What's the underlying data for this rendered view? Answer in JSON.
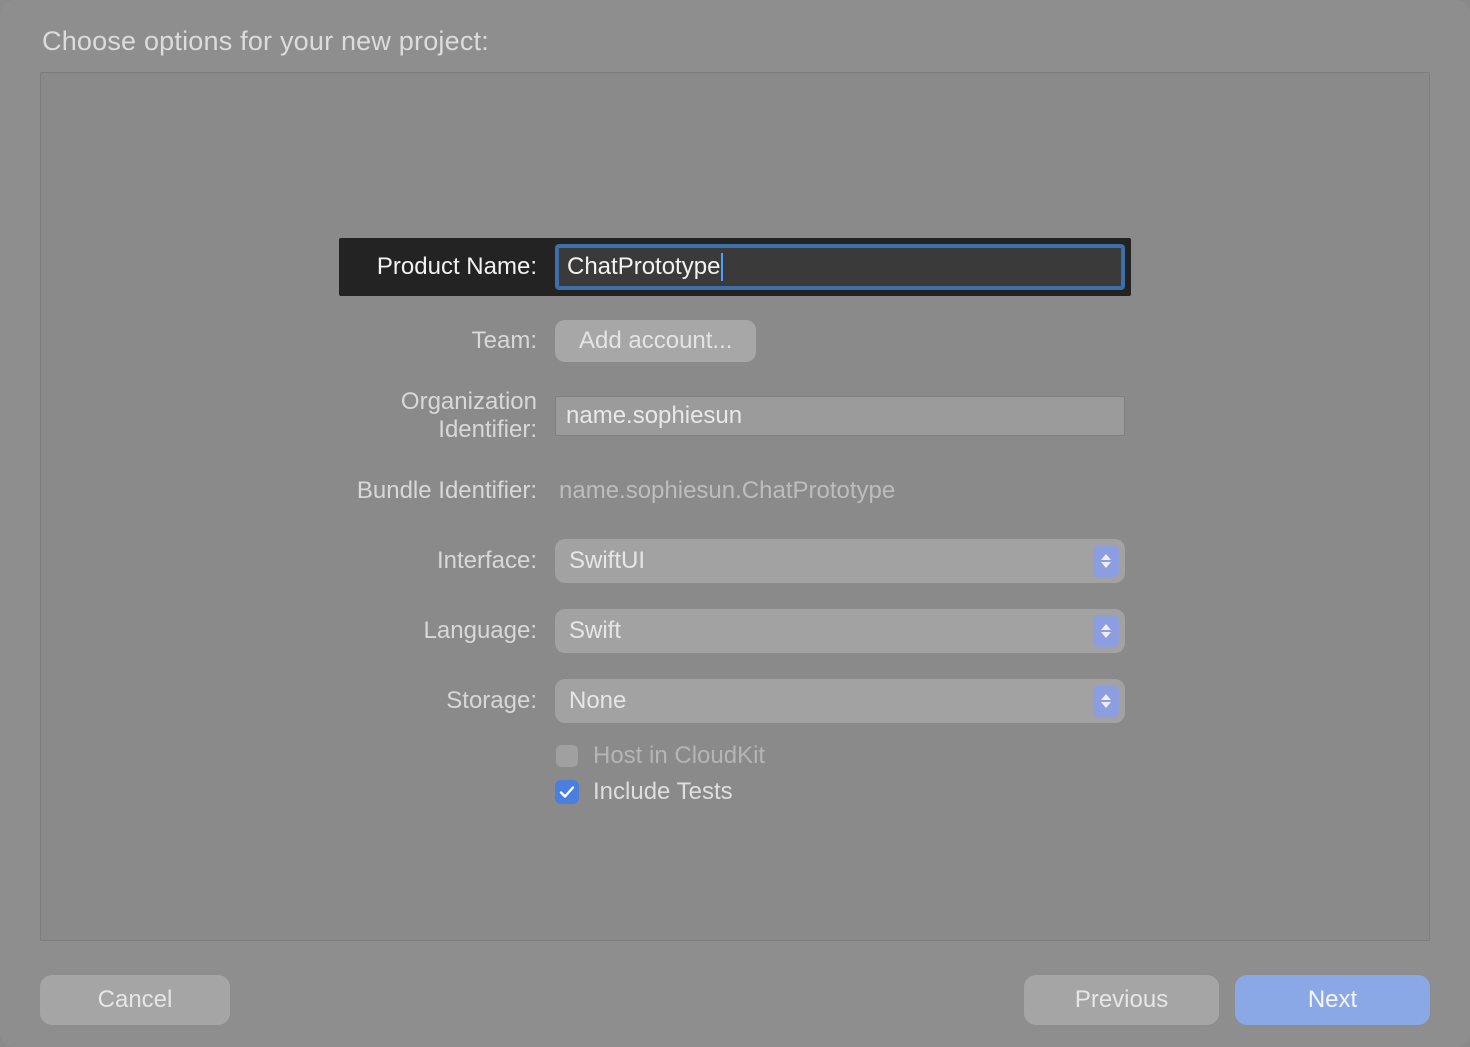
{
  "dialog": {
    "title": "Choose options for your new project:"
  },
  "form": {
    "product_name": {
      "label": "Product Name:",
      "value": "ChatPrototype"
    },
    "team": {
      "label": "Team:",
      "button": "Add account..."
    },
    "org_identifier": {
      "label": "Organization Identifier:",
      "value": "name.sophiesun"
    },
    "bundle_identifier": {
      "label": "Bundle Identifier:",
      "value": "name.sophiesun.ChatPrototype"
    },
    "interface": {
      "label": "Interface:",
      "value": "SwiftUI"
    },
    "language": {
      "label": "Language:",
      "value": "Swift"
    },
    "storage": {
      "label": "Storage:",
      "value": "None"
    },
    "host_cloudkit": {
      "label": "Host in CloudKit",
      "checked": false,
      "enabled": false
    },
    "include_tests": {
      "label": "Include Tests",
      "checked": true,
      "enabled": true
    }
  },
  "buttons": {
    "cancel": "Cancel",
    "previous": "Previous",
    "next": "Next"
  }
}
